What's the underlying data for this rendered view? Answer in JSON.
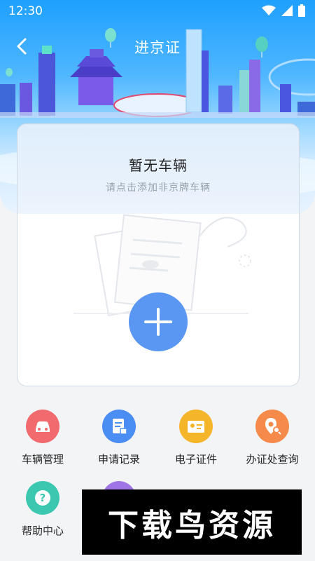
{
  "status": {
    "time": "12:30"
  },
  "header": {
    "title": "进京证"
  },
  "card": {
    "title": "暂无车辆",
    "subtitle": "请点击添加非京牌车辆"
  },
  "menu": [
    {
      "label": "车辆管理",
      "icon": "car-icon",
      "color": "#f16a6e"
    },
    {
      "label": "申请记录",
      "icon": "document-icon",
      "color": "#4a8df3"
    },
    {
      "label": "电子证件",
      "icon": "id-card-icon",
      "color": "#f5b52a"
    },
    {
      "label": "办证处查询",
      "icon": "location-search-icon",
      "color": "#f58a4a"
    },
    {
      "label": "帮助中心",
      "icon": "question-icon",
      "color": "#3cc7b0"
    },
    {
      "label": "",
      "icon": "unknown-icon",
      "color": "#9f75e6"
    }
  ],
  "watermark": {
    "text": "下载鸟资源"
  }
}
